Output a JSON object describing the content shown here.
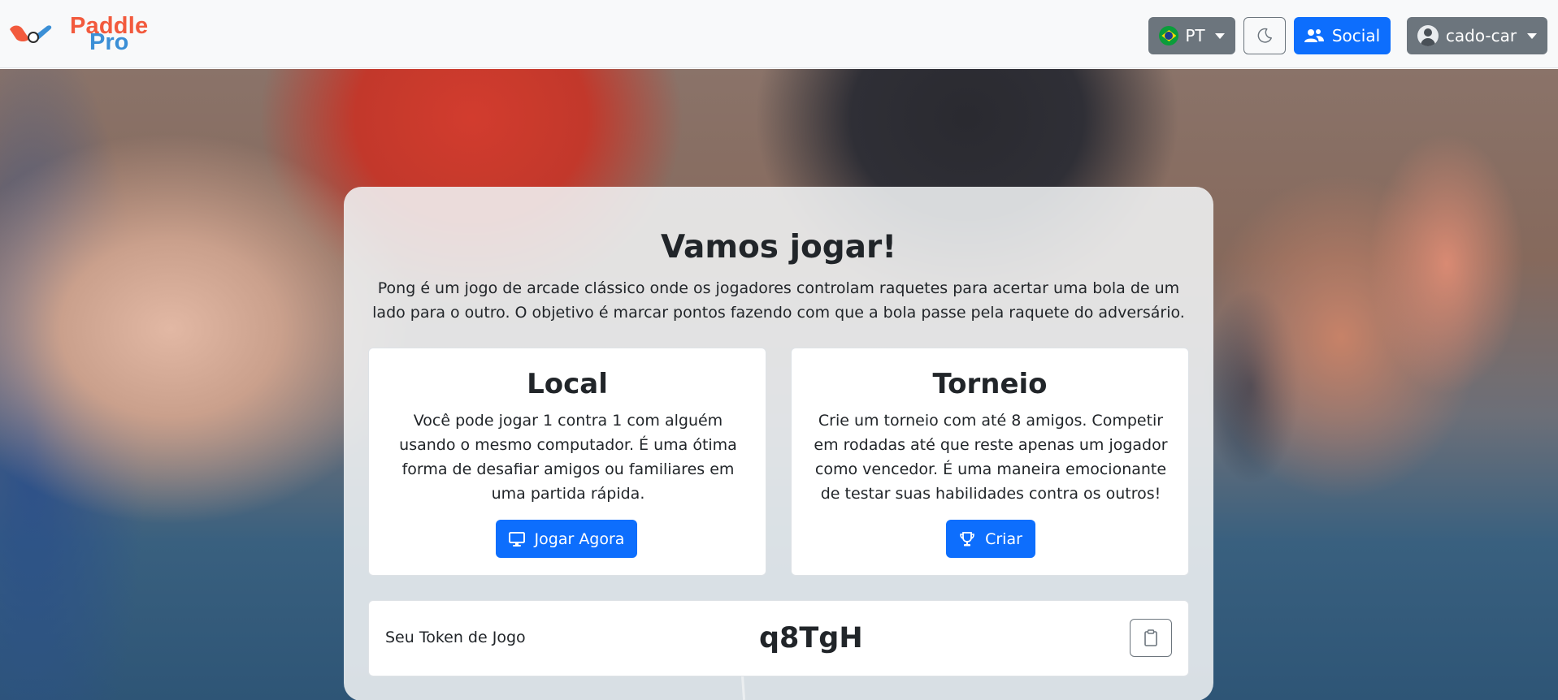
{
  "brand": {
    "line1": "Paddle",
    "line2": "Pro",
    "logo_icon": "paddle-ball-logo"
  },
  "navbar": {
    "language": {
      "label": "PT",
      "icon": "brazil-flag-icon"
    },
    "theme_toggle": {
      "icon": "moon-icon"
    },
    "social": {
      "label": "Social",
      "icon": "people-icon"
    },
    "user": {
      "label": "cado-car",
      "icon": "user-circle-icon"
    }
  },
  "main": {
    "title": "Vamos jogar!",
    "description": "Pong é um jogo de arcade clássico onde os jogadores controlam raquetes para acertar uma bola de um lado para o outro. O objetivo é marcar pontos fazendo com que a bola passe pela raquete do adversário.",
    "modes": [
      {
        "title": "Local",
        "text": "Você pode jogar 1 contra 1 com alguém usando o mesmo computador. É uma ótima forma de desafiar amigos ou familiares em uma partida rápida.",
        "button_label": "Jogar Agora",
        "button_icon": "monitor-icon"
      },
      {
        "title": "Torneio",
        "text": "Crie um torneio com até 8 amigos. Competir em rodadas até que reste apenas um jogador como vencedor. É uma maneira emocionante de testar suas habilidades contra os outros!",
        "button_label": "Criar",
        "button_icon": "trophy-icon"
      }
    ],
    "token": {
      "label": "Seu Token de Jogo",
      "value": "q8TgH",
      "copy_icon": "clipboard-icon"
    }
  },
  "colors": {
    "primary": "#0d6efd",
    "secondary": "#6c757d",
    "brand_orange": "#f25a3d",
    "brand_blue": "#3b8fd6"
  }
}
